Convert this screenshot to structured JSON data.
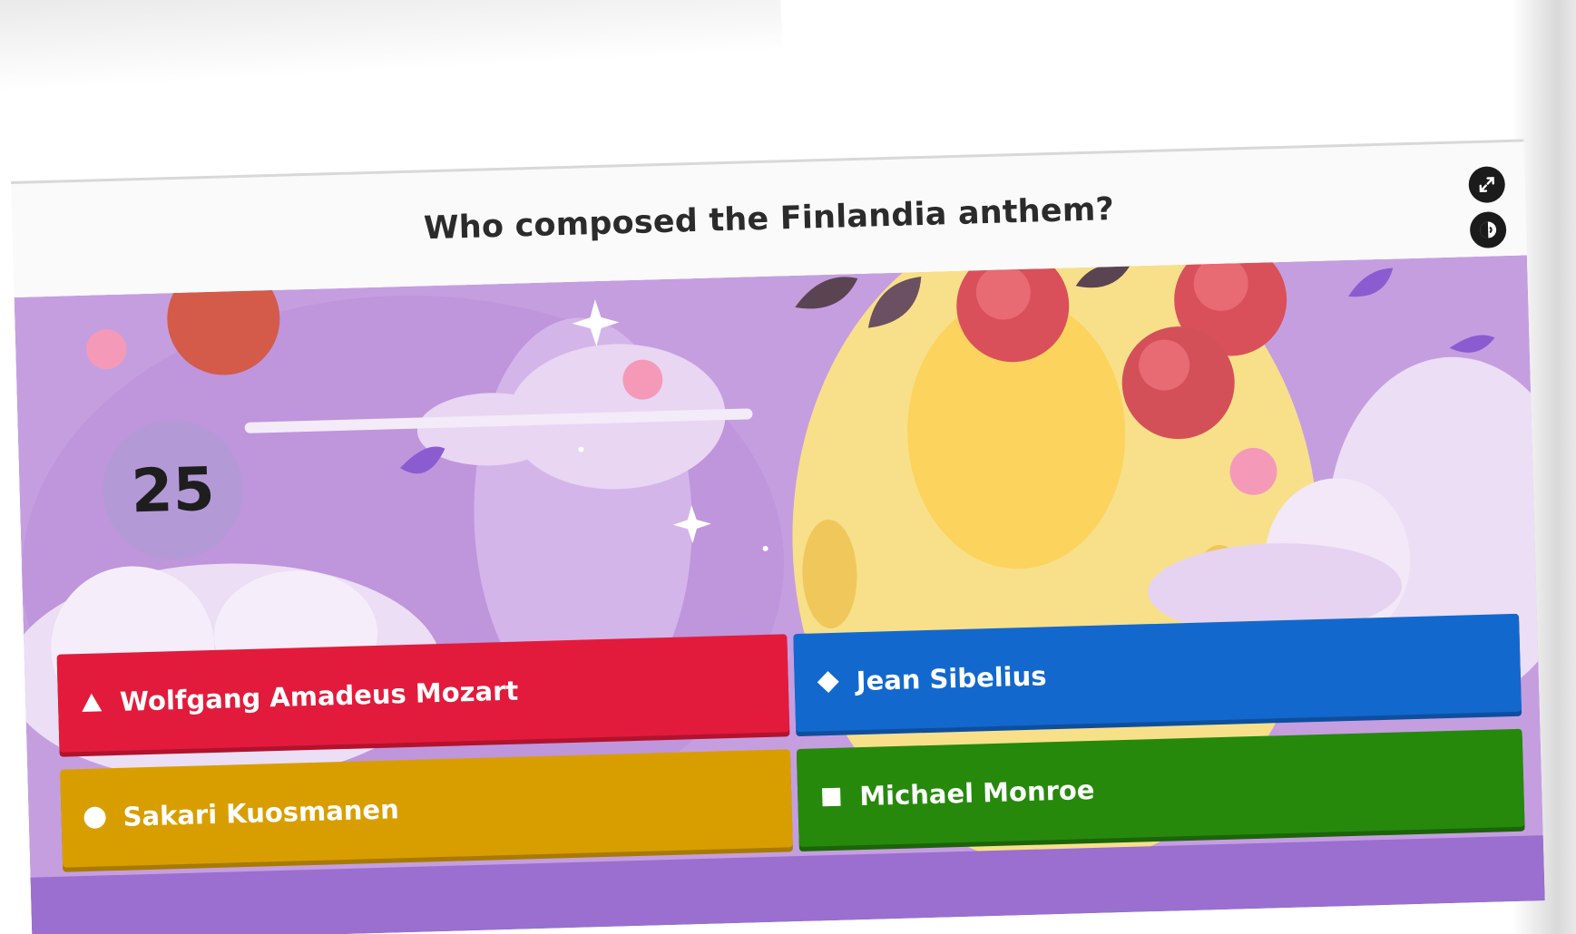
{
  "question": {
    "text": "Who composed the Finlandia anthem?"
  },
  "controls": {
    "fullscreen_icon": "fullscreen-icon",
    "sound_icon": "sound-icon"
  },
  "timer": {
    "value": "25"
  },
  "answers": [
    {
      "shape": "triangle",
      "label": "Wolfgang Amadeus Mozart",
      "color": "#e21b3c"
    },
    {
      "shape": "diamond",
      "label": "Jean Sibelius",
      "color": "#1368ce"
    },
    {
      "shape": "circle",
      "label": "Sakari Kuosmanen",
      "color": "#d89e00"
    },
    {
      "shape": "square",
      "label": "Michael Monroe",
      "color": "#26890c"
    }
  ],
  "theme": {
    "background": "#c59ee0",
    "accent_purple": "#8b5ccf"
  }
}
